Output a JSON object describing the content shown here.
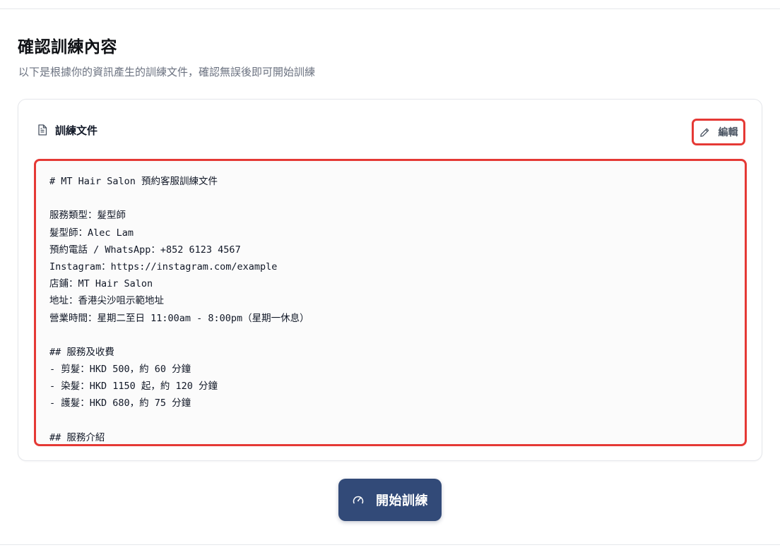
{
  "page": {
    "title": "確認訓練內容",
    "subtitle": "以下是根據你的資訊產生的訓練文件，確認無誤後即可開始訓練"
  },
  "card": {
    "title": "訓練文件",
    "icon": "document-icon",
    "edit_label": "編輯",
    "edit_icon": "pencil-icon",
    "highlight_color": "#e53935"
  },
  "document": {
    "lines": [
      "# MT Hair Salon 預約客服訓練文件",
      "",
      "服務類型：髮型師",
      "髮型師：Alec Lam",
      "預約電話 / WhatsApp：+852 6123 4567",
      "Instagram：https://instagram.com/example",
      "店鋪：MT Hair Salon",
      "地址：香港尖沙咀示範地址",
      "營業時間：星期二至日 11:00am - 8:00pm（星期一休息）",
      "",
      "## 服務及收費",
      "- 剪髮：HKD 500，約 60 分鐘",
      "- 染髮：HKD 1150 起，約 120 分鐘",
      "- 護髮：HKD 680，約 75 分鐘",
      "",
      "## 服務介紹"
    ]
  },
  "actions": {
    "start_label": "開始訓練",
    "start_icon": "gauge-icon",
    "start_color": "#324a78"
  }
}
